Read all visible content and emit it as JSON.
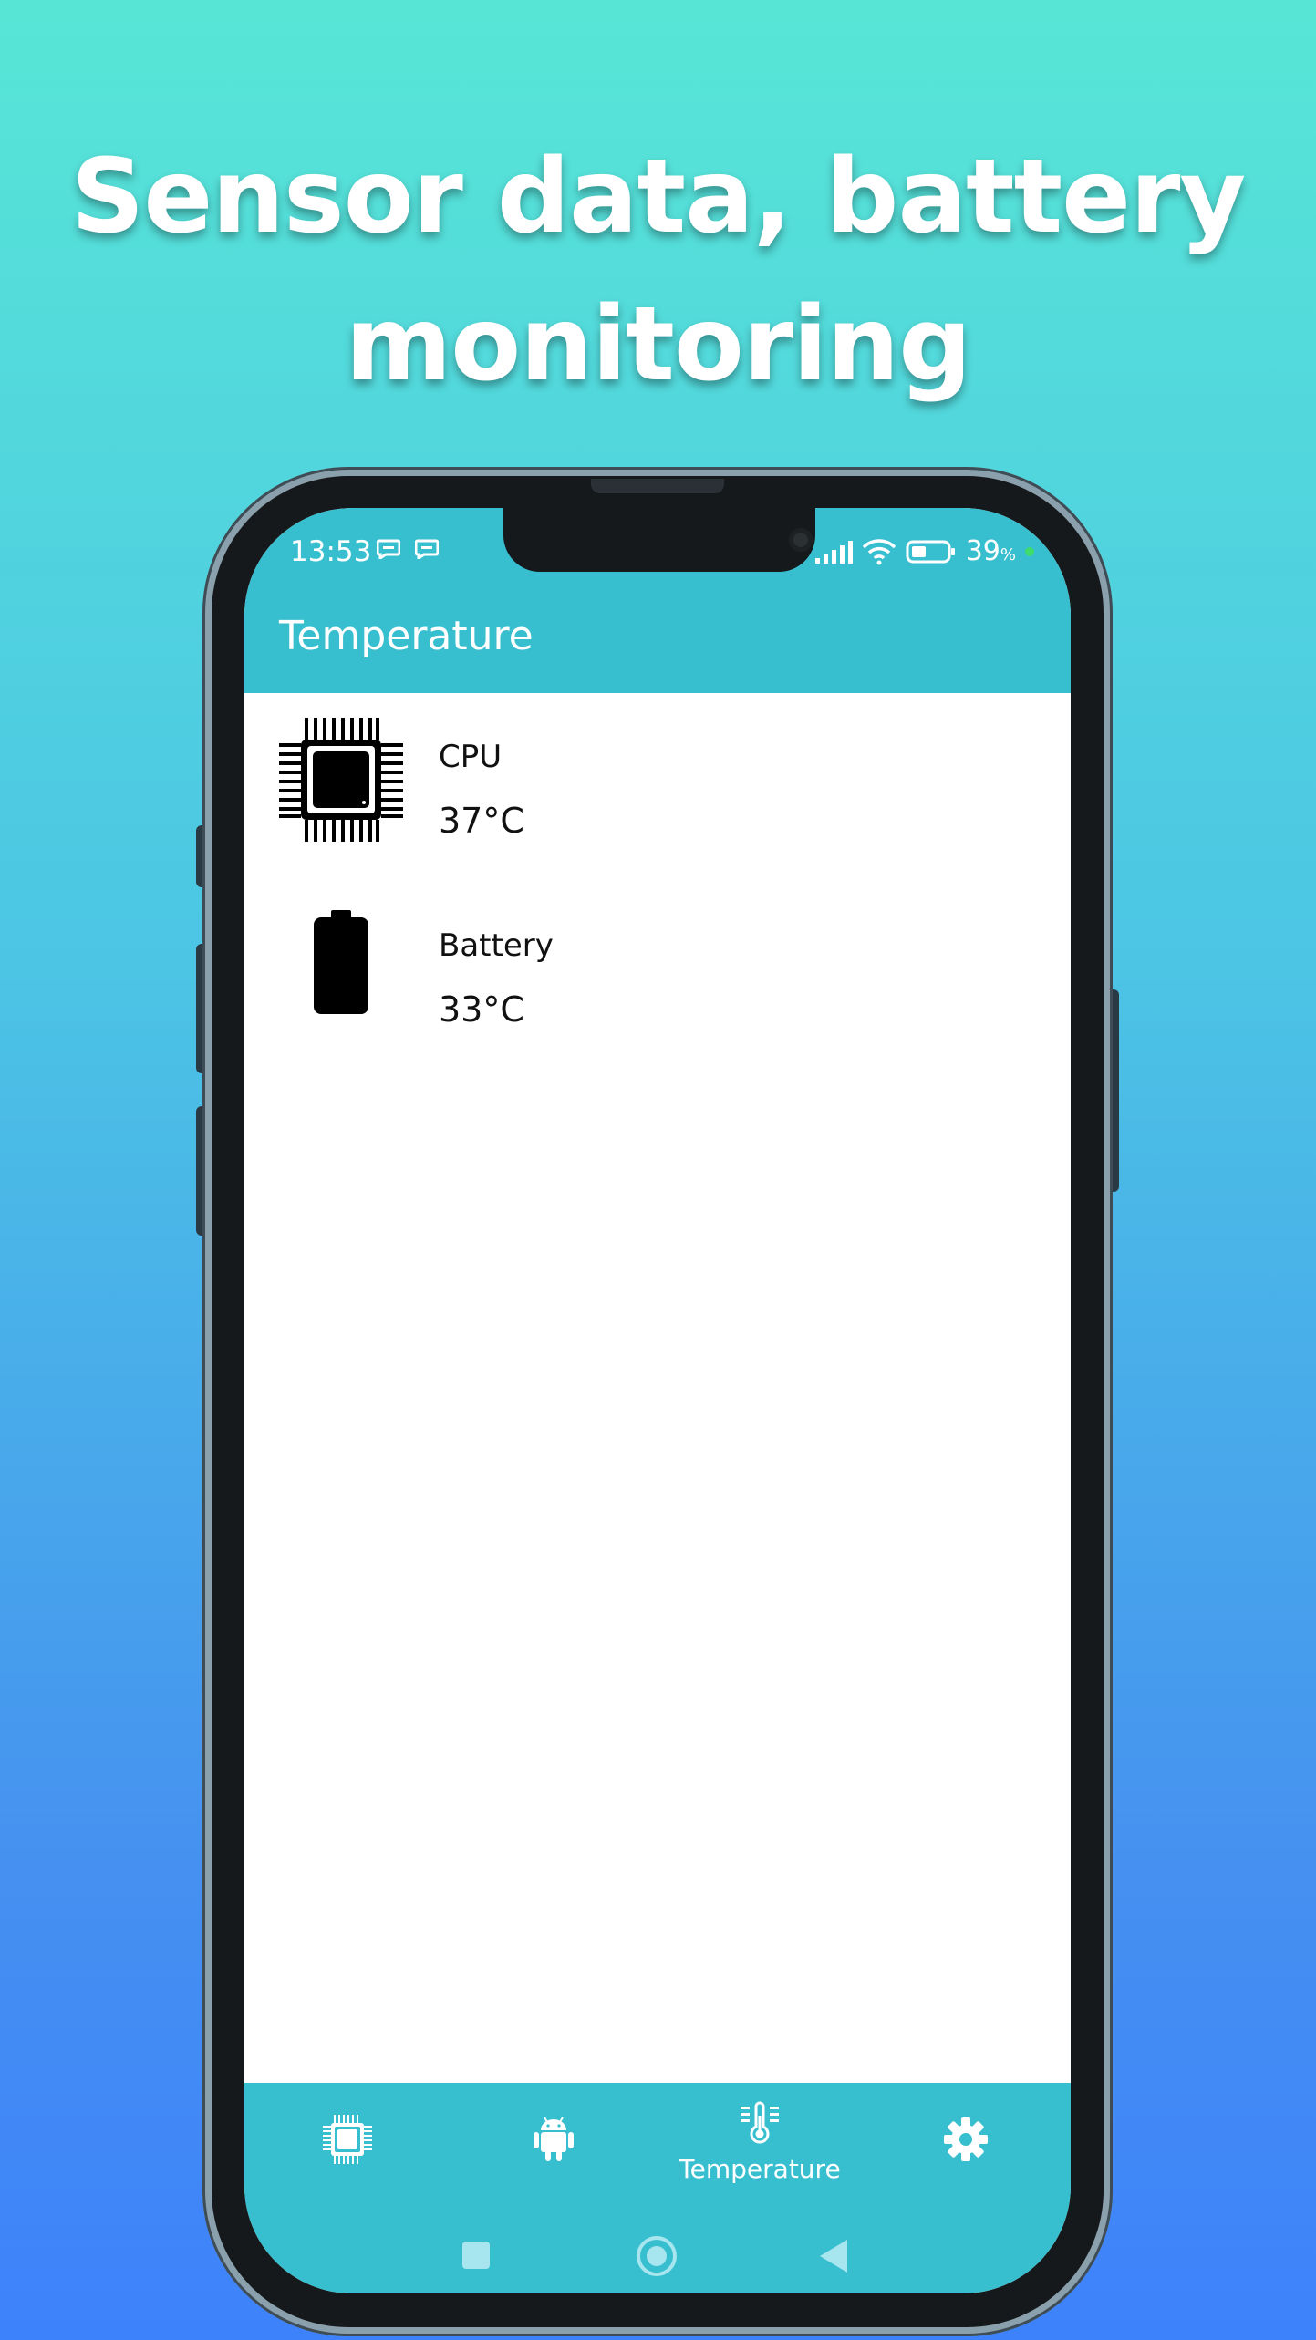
{
  "headline": {
    "line1": "Sensor data, battery",
    "line2": "monitoring"
  },
  "status_bar": {
    "time": "13:53",
    "battery_percent": "39",
    "percent_sign": "%"
  },
  "app_bar": {
    "title": "Temperature"
  },
  "sensors": [
    {
      "label": "CPU",
      "value": "37°C",
      "icon": "cpu-chip-icon"
    },
    {
      "label": "Battery",
      "value": "33°C",
      "icon": "battery-icon"
    }
  ],
  "bottom_nav": {
    "items": [
      {
        "icon": "cpu-chip-icon",
        "label": ""
      },
      {
        "icon": "android-icon",
        "label": ""
      },
      {
        "icon": "thermometer-icon",
        "label": "Temperature",
        "active": true
      },
      {
        "icon": "gear-icon",
        "label": ""
      }
    ]
  },
  "system_nav": [
    "recents-square-icon",
    "home-circle-icon",
    "back-triangle-icon"
  ],
  "colors": {
    "accent": "#38bfcf",
    "background_top": "#57e6d6",
    "background_bottom": "#3e82fb"
  }
}
